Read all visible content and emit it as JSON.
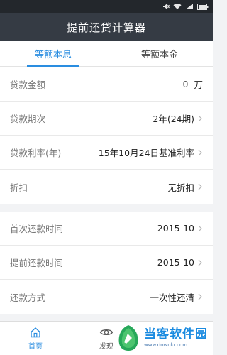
{
  "status_bar": {
    "icons": [
      "mute-icon",
      "wifi-icon",
      "signal-icon",
      "battery-icon"
    ]
  },
  "header": {
    "title": "提前还贷计算器"
  },
  "tabs": [
    {
      "label": "等额本息",
      "active": true
    },
    {
      "label": "等额本金",
      "active": false
    }
  ],
  "loan_group": [
    {
      "label": "贷款金额",
      "value": "0",
      "unit": "万"
    },
    {
      "label": "贷款期次",
      "value": "2年(24期)"
    },
    {
      "label": "贷款利率(年)",
      "value": "15年10月24日基准利率"
    },
    {
      "label": "折扣",
      "value": "无折扣"
    }
  ],
  "repay_group": [
    {
      "label": "首次还款时间",
      "value": "2015-10"
    },
    {
      "label": "提前还款时间",
      "value": "2015-10"
    },
    {
      "label": "还款方式",
      "value": "一次性还清"
    }
  ],
  "bottom_nav": [
    {
      "label": "首页",
      "icon": "home-icon",
      "active": true
    },
    {
      "label": "发现",
      "icon": "eye-icon",
      "active": false
    }
  ],
  "watermark": {
    "main": "当客软件园",
    "sub": "www.downkr.com"
  },
  "colors": {
    "accent": "#2a8de0",
    "header": "#353b44",
    "status": "#23272c"
  }
}
